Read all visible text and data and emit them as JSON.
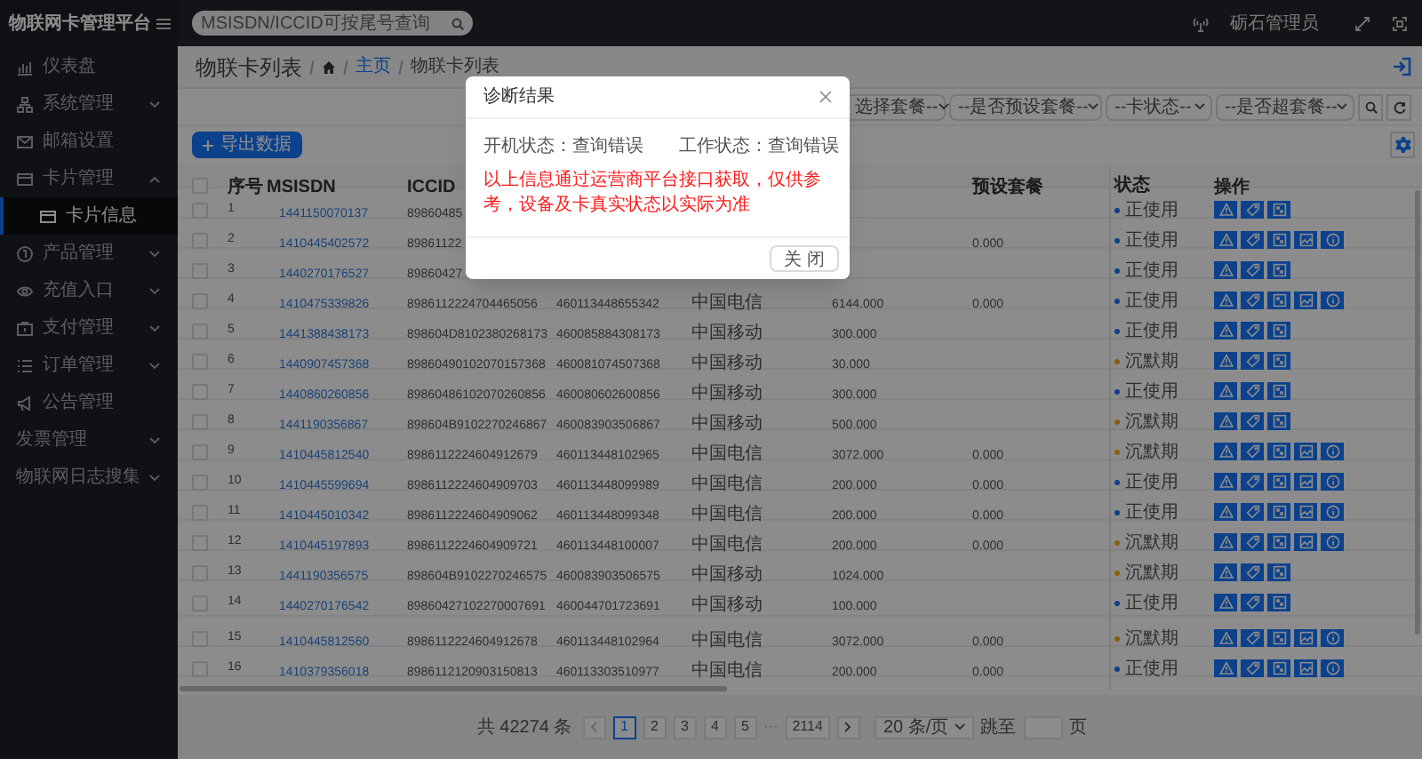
{
  "header": {
    "title": "物联网卡管理平台",
    "search": {
      "placeholder": "MSISDN/ICCID可按尾号查询"
    },
    "user": "砺石管理员"
  },
  "sidebar": {
    "items": [
      {
        "label": "仪表盘",
        "kind": "dashboard",
        "expandable": false,
        "expanded": false,
        "selected": false
      },
      {
        "label": "系统管理",
        "kind": "system",
        "expandable": true,
        "expanded": false,
        "selected": false
      },
      {
        "label": "邮箱设置",
        "kind": "mail",
        "expandable": false,
        "expanded": false,
        "selected": false
      },
      {
        "label": "卡片管理",
        "kind": "card",
        "expandable": true,
        "expanded": true,
        "selected": false,
        "children": [
          {
            "label": "卡片信息",
            "kind": "card",
            "selected": true
          }
        ]
      },
      {
        "label": "产品管理",
        "kind": "product",
        "expandable": true,
        "expanded": false,
        "selected": false
      },
      {
        "label": "充值入口",
        "kind": "recharge",
        "expandable": true,
        "expanded": false,
        "selected": false
      },
      {
        "label": "支付管理",
        "kind": "pay",
        "expandable": true,
        "expanded": false,
        "selected": false
      },
      {
        "label": "订单管理",
        "kind": "order",
        "expandable": true,
        "expanded": false,
        "selected": false
      },
      {
        "label": "公告管理",
        "kind": "notice",
        "expandable": false,
        "expanded": false,
        "selected": false
      },
      {
        "label": "发票管理",
        "kind": "plain",
        "expandable": true,
        "expanded": false,
        "selected": false
      },
      {
        "label": "物联网日志搜集",
        "kind": "plain",
        "expandable": true,
        "expanded": false,
        "selected": false
      }
    ]
  },
  "breadcrumb": {
    "title": "物联卡列表",
    "items": [
      {
        "label": "主页",
        "kind": "link"
      },
      {
        "label": "物联卡列表",
        "kind": "current"
      }
    ]
  },
  "filters": [
    {
      "placeholder": "选择套餐--"
    },
    {
      "placeholder": "--是否预设套餐--"
    },
    {
      "placeholder": "--卡状态--"
    },
    {
      "placeholder": "--是否超套餐--"
    }
  ],
  "toolbar": {
    "export_button": "导出数据"
  },
  "table": {
    "header_checked": false,
    "columns": {
      "seq": "序号",
      "msisdn": "MSISDN",
      "iccid": "ICCID",
      "preset": "预设套餐",
      "status": "状态",
      "actions": "操作"
    },
    "rows": [
      {
        "checked": false,
        "seq": "1",
        "msisdn": "1441150070137",
        "iccid": "89860485",
        "status": "正使用",
        "color": "#0c418c",
        "actions": [
          {
            "kind": "alert"
          },
          {
            "kind": "tag"
          },
          {
            "kind": "qr"
          }
        ]
      },
      {
        "checked": false,
        "seq": "2",
        "msisdn": "1410445402572",
        "iccid": "89861122",
        "preset": "0.000",
        "status": "正使用",
        "color": "#0c418c",
        "actions": [
          {
            "kind": "alert"
          },
          {
            "kind": "tag"
          },
          {
            "kind": "qr"
          },
          {
            "kind": "image"
          },
          {
            "kind": "info"
          }
        ]
      },
      {
        "checked": false,
        "seq": "3",
        "msisdn": "1440270176527",
        "iccid": "89860427",
        "status": "正使用",
        "color": "#0c418c",
        "actions": [
          {
            "kind": "alert"
          },
          {
            "kind": "tag"
          },
          {
            "kind": "qr"
          }
        ]
      },
      {
        "checked": false,
        "seq": "4",
        "msisdn": "1410475339826",
        "iccid": "8986112224704465056",
        "column_5": "460113448655342",
        "column_6": "中国电信",
        "column_7": "6144.000",
        "preset": "0.000",
        "status": "正使用",
        "color": "#0c418c",
        "actions": [
          {
            "kind": "alert"
          },
          {
            "kind": "tag"
          },
          {
            "kind": "qr"
          },
          {
            "kind": "image"
          },
          {
            "kind": "info"
          }
        ]
      },
      {
        "checked": false,
        "seq": "5",
        "msisdn": "1441388438173",
        "iccid": "898604D8102380268173",
        "column_5": "460085884308173",
        "column_6": "中国移动",
        "column_7": "300.000",
        "status": "正使用",
        "color": "#0c418c",
        "actions": [
          {
            "kind": "alert"
          },
          {
            "kind": "tag"
          },
          {
            "kind": "qr"
          }
        ]
      },
      {
        "checked": false,
        "seq": "6",
        "msisdn": "1440907457368",
        "iccid": "89860490102070157368",
        "column_5": "460081074507368",
        "column_6": "中国移动",
        "column_7": "30.000",
        "status": "沉默期",
        "color": "#8a5f0b",
        "actions": [
          {
            "kind": "alert"
          },
          {
            "kind": "tag"
          },
          {
            "kind": "qr"
          }
        ]
      },
      {
        "checked": false,
        "seq": "7",
        "msisdn": "1440860260856",
        "iccid": "89860486102070260856",
        "column_5": "460080602600856",
        "column_6": "中国移动",
        "column_7": "300.000",
        "status": "正使用",
        "color": "#0c418c",
        "actions": [
          {
            "kind": "alert"
          },
          {
            "kind": "tag"
          },
          {
            "kind": "qr"
          }
        ]
      },
      {
        "checked": false,
        "seq": "8",
        "msisdn": "1441190356867",
        "iccid": "898604B9102270246867",
        "column_5": "460083903506867",
        "column_6": "中国移动",
        "column_7": "500.000",
        "status": "沉默期",
        "color": "#8a5f0b",
        "actions": [
          {
            "kind": "alert"
          },
          {
            "kind": "tag"
          },
          {
            "kind": "qr"
          }
        ]
      },
      {
        "checked": false,
        "seq": "9",
        "msisdn": "1410445812540",
        "iccid": "8986112224604912679",
        "column_5": "460113448102965",
        "column_6": "中国电信",
        "column_7": "3072.000",
        "preset": "0.000",
        "status": "沉默期",
        "color": "#8a5f0b",
        "actions": [
          {
            "kind": "alert"
          },
          {
            "kind": "tag"
          },
          {
            "kind": "qr"
          },
          {
            "kind": "image"
          },
          {
            "kind": "info"
          }
        ]
      },
      {
        "checked": false,
        "seq": "10",
        "msisdn": "1410445599694",
        "iccid": "8986112224604909703",
        "column_5": "460113448099989",
        "column_6": "中国电信",
        "column_7": "200.000",
        "preset": "0.000",
        "status": "正使用",
        "color": "#0c418c",
        "actions": [
          {
            "kind": "alert"
          },
          {
            "kind": "tag"
          },
          {
            "kind": "qr"
          },
          {
            "kind": "image"
          },
          {
            "kind": "info"
          }
        ]
      },
      {
        "checked": false,
        "seq": "11",
        "msisdn": "1410445010342",
        "iccid": "8986112224604909062",
        "column_5": "460113448099348",
        "column_6": "中国电信",
        "column_7": "200.000",
        "preset": "0.000",
        "status": "正使用",
        "color": "#0c418c",
        "actions": [
          {
            "kind": "alert"
          },
          {
            "kind": "tag"
          },
          {
            "kind": "qr"
          },
          {
            "kind": "image"
          },
          {
            "kind": "info"
          }
        ]
      },
      {
        "checked": false,
        "seq": "12",
        "msisdn": "1410445197893",
        "iccid": "8986112224604909721",
        "column_5": "460113448100007",
        "column_6": "中国电信",
        "column_7": "200.000",
        "preset": "0.000",
        "status": "沉默期",
        "color": "#8a5f0b",
        "actions": [
          {
            "kind": "alert"
          },
          {
            "kind": "tag"
          },
          {
            "kind": "qr"
          },
          {
            "kind": "image"
          },
          {
            "kind": "info"
          }
        ]
      },
      {
        "checked": false,
        "seq": "13",
        "msisdn": "1441190356575",
        "iccid": "898604B9102270246575",
        "column_5": "460083903506575",
        "column_6": "中国移动",
        "column_7": "1024.000",
        "status": "沉默期",
        "color": "#8a5f0b",
        "actions": [
          {
            "kind": "alert"
          },
          {
            "kind": "tag"
          },
          {
            "kind": "qr"
          }
        ]
      },
      {
        "checked": false,
        "seq": "14",
        "msisdn": "1440270176542",
        "iccid": "89860427102270007691",
        "column_5": "460044701723691",
        "column_6": "中国移动",
        "column_7": "100.000",
        "status": "正使用",
        "color": "#0c418c",
        "actions": [
          {
            "kind": "alert"
          },
          {
            "kind": "tag"
          },
          {
            "kind": "qr"
          }
        ]
      },
      {
        "checked": false,
        "seq": "15",
        "msisdn": "1410445812560",
        "iccid": "8986112224604912678",
        "column_5": "460113448102964",
        "column_6": "中国电信",
        "column_7": "3072.000",
        "preset": "0.000",
        "status": "沉默期",
        "color": "#8a5f0b",
        "actions": [
          {
            "kind": "alert"
          },
          {
            "kind": "tag"
          },
          {
            "kind": "qr"
          },
          {
            "kind": "image"
          },
          {
            "kind": "info"
          }
        ]
      },
      {
        "checked": false,
        "seq": "16",
        "msisdn": "1410379356018",
        "iccid": "8986112120903150813",
        "column_5": "460113303510977",
        "column_6": "中国电信",
        "column_7": "200.000",
        "preset": "0.000",
        "status": "正使用",
        "color": "#0c418c",
        "actions": [
          {
            "kind": "alert"
          },
          {
            "kind": "tag"
          },
          {
            "kind": "qr"
          },
          {
            "kind": "image"
          },
          {
            "kind": "info"
          }
        ]
      }
    ]
  },
  "pagination": {
    "total": "共 42274 条",
    "pages": [
      {
        "label": "1",
        "kind": "page",
        "selected": true
      },
      {
        "label": "2",
        "kind": "page",
        "selected": false
      },
      {
        "label": "3",
        "kind": "page",
        "selected": false
      },
      {
        "label": "4",
        "kind": "page",
        "selected": false
      },
      {
        "label": "5",
        "kind": "page",
        "selected": false
      },
      {
        "label": "···",
        "kind": "ellipsis",
        "selected": false
      },
      {
        "label": "2114",
        "kind": "page",
        "selected": false
      }
    ],
    "page_size": "20 条/页",
    "jump_label": "跳至",
    "jump_suffix": "页"
  },
  "modal": {
    "title": "诊断结果",
    "fields": [
      "开机状态：查询错误",
      "工作状态：查询错误"
    ],
    "notice": "以上信息通过运营商平台接口获取，仅供参考，设备及卡真实状态以实际为准",
    "close_button": "关 闭"
  }
}
